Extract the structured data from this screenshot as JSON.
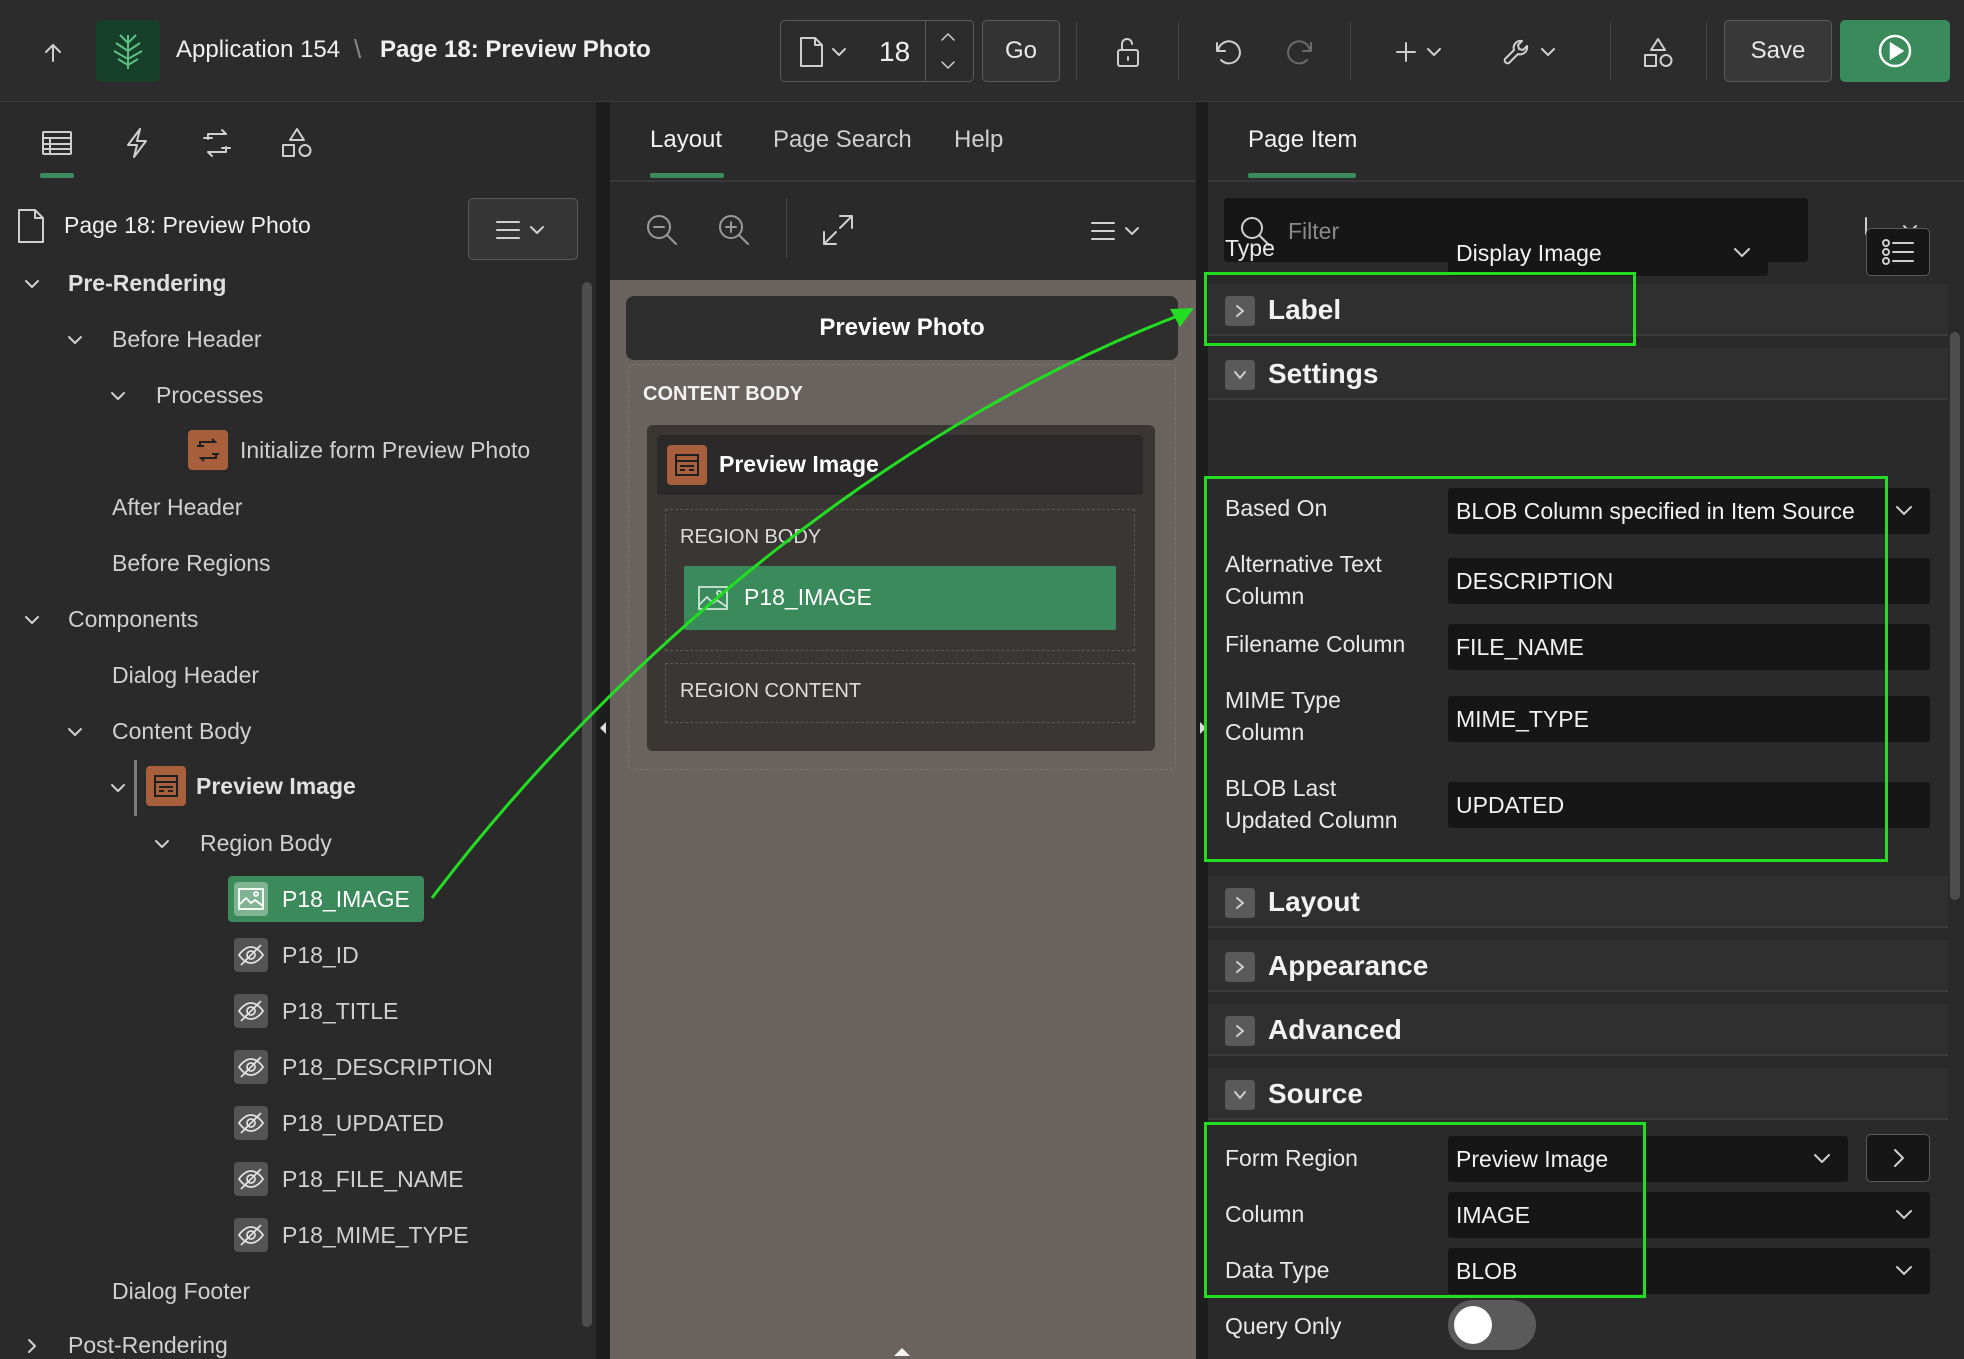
{
  "topbar": {
    "app_name": "Application 154",
    "separator": "\\",
    "page_title": "Page 18: Preview Photo",
    "page_number": "18",
    "go_label": "Go",
    "save_label": "Save"
  },
  "left": {
    "page_node": "Page 18: Preview Photo",
    "tree": {
      "pre_rendering": "Pre-Rendering",
      "before_header": "Before Header",
      "processes": "Processes",
      "process_init": "Initialize form Preview Photo",
      "after_header": "After Header",
      "before_regions": "Before Regions",
      "components": "Components",
      "dialog_header": "Dialog Header",
      "content_body": "Content Body",
      "preview_image": "Preview Image",
      "region_body": "Region Body",
      "items": [
        "P18_IMAGE",
        "P18_ID",
        "P18_TITLE",
        "P18_DESCRIPTION",
        "P18_UPDATED",
        "P18_FILE_NAME",
        "P18_MIME_TYPE"
      ],
      "dialog_footer": "Dialog Footer",
      "post_rendering": "Post-Rendering"
    }
  },
  "middle": {
    "tabs": [
      "Layout",
      "Page Search",
      "Help"
    ],
    "dialog_title": "Preview Photo",
    "content_body": "CONTENT BODY",
    "region_title": "Preview Image",
    "region_body": "REGION BODY",
    "item": "P18_IMAGE",
    "region_content": "REGION CONTENT"
  },
  "right": {
    "tab": "Page Item",
    "filter_placeholder": "Filter",
    "type_label": "Type",
    "type_value": "Display Image",
    "sections": {
      "label": "Label",
      "settings": "Settings",
      "layout": "Layout",
      "appearance": "Appearance",
      "advanced": "Advanced",
      "source": "Source"
    },
    "settings": {
      "based_on_label": "Based On",
      "based_on_value": "BLOB Column specified in Item Source",
      "alt_text_label_1": "Alternative Text",
      "alt_text_label_2": "Column",
      "alt_text_value": "DESCRIPTION",
      "filename_label": "Filename Column",
      "filename_value": "FILE_NAME",
      "mime_label_1": "MIME Type",
      "mime_label_2": "Column",
      "mime_value": "MIME_TYPE",
      "blob_label_1": "BLOB Last",
      "blob_label_2": "Updated Column",
      "blob_value": "UPDATED"
    },
    "source": {
      "form_region_label": "Form Region",
      "form_region_value": "Preview Image",
      "column_label": "Column",
      "column_value": "IMAGE",
      "data_type_label": "Data Type",
      "data_type_value": "BLOB",
      "query_only_label": "Query Only"
    }
  },
  "colors": {
    "accent_green": "#3b8a5b",
    "highlight": "#22dd22",
    "region_icon": "#a8603c"
  }
}
